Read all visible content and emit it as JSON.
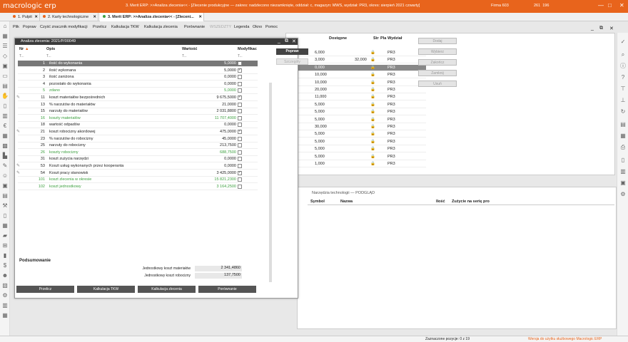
{
  "app": {
    "logo": "macrologic erp",
    "title": "3. Merit ERP: >>Analiza zlecenia<< - [Zlecenie produkcyjne — zakres: nadzlecono niezamknięte, oddział: c, magazyn: MWS, wydział: PR3, okres: sierpień 2021 czwarty]",
    "firma": "Firma 603",
    "num1": "261",
    "num2": "196"
  },
  "tabs": [
    {
      "label": "1. Pulpit",
      "color": "#e8641c"
    },
    {
      "label": "2. Karty technologiczne",
      "color": "#e8641c"
    },
    {
      "label": "3. Merit ERP: >>Analiza zlecenia<< - [Zleceni...",
      "color": "#3ea040"
    }
  ],
  "menu": [
    "Plik",
    "Popraw",
    "Czyść znacznik modyfikacji",
    "Przelicz",
    "Kalkulacja TKW",
    "Kalkulacja zlecenia",
    "Porównanie",
    "WSZEDZTY",
    "Legenda",
    "Okno",
    "Pomoc"
  ],
  "bg": {
    "headers": {
      "dostepne": "Dostępne",
      "str": "Str",
      "pla": "Pla",
      "wydzial": "Wydział"
    },
    "rows": [
      {
        "a": "6,000",
        "b": "",
        "w": "PR3"
      },
      {
        "a": "3,000",
        "b": "32,000",
        "w": "PR3"
      },
      {
        "a": "0,000",
        "b": "",
        "w": "PR3"
      },
      {
        "a": "10,000",
        "b": "",
        "w": "PR3"
      },
      {
        "a": "10,000",
        "b": "",
        "w": "PR3"
      },
      {
        "a": "20,000",
        "b": "",
        "w": "PR3"
      },
      {
        "a": "11,000",
        "b": "",
        "w": "PR3"
      },
      {
        "a": "5,000",
        "b": "",
        "w": "PR3"
      },
      {
        "a": "5,000",
        "b": "",
        "w": "PR3"
      },
      {
        "a": "5,000",
        "b": "",
        "w": "PR3"
      },
      {
        "a": "30,000",
        "b": "",
        "w": "PR3"
      },
      {
        "a": "5,000",
        "b": "",
        "w": "PR3"
      },
      {
        "a": "5,000",
        "b": "",
        "w": "PR3"
      },
      {
        "a": "5,000",
        "b": "",
        "w": "PR3"
      },
      {
        "a": "5,000",
        "b": "",
        "w": "PR3"
      },
      {
        "a": "1,000",
        "b": "",
        "w": "PR3"
      }
    ],
    "buttons": [
      "Dodaj",
      "Wybierz",
      "Zakończ",
      "Zamknij",
      "Usuń"
    ]
  },
  "lower": {
    "tab": "Narzędzia technologii — PODGLĄD",
    "symbol": "Symbol",
    "nazwa": "Nazwa",
    "ilosc": "Ilość",
    "zuzycie": "Zużycie na serię pro"
  },
  "dialog": {
    "title": "Analiza zlecenia: 2021/P/00049",
    "h_nr": "Nr",
    "h_opis": "Opis",
    "h_wartosc": "Wartość",
    "h_modyf": "Modyfikac",
    "filter": "T...",
    "btn_popraw": "Popraw",
    "btn_szczegoly": "Szczegóły",
    "rows": [
      {
        "nr": "1",
        "opis": "ilość do wykonania",
        "val": "5,0000",
        "chk": false,
        "sel": true,
        "green": false,
        "pen": false
      },
      {
        "nr": "2",
        "opis": "ilość wykonana",
        "val": "5,0000",
        "chk": true,
        "sel": false,
        "green": false,
        "pen": false
      },
      {
        "nr": "3",
        "opis": "ilość zaniżona",
        "val": "0,0000",
        "chk": false,
        "sel": false,
        "green": false,
        "pen": false
      },
      {
        "nr": "4",
        "opis": "pozostało do wykonania",
        "val": "0,0000",
        "chk": false,
        "sel": false,
        "green": false,
        "pen": false
      },
      {
        "nr": "5",
        "opis": "zdano",
        "val": "5,0000",
        "chk": false,
        "sel": false,
        "green": true,
        "pen": false
      },
      {
        "nr": "11",
        "opis": "koszt materiałów bezpośrednich",
        "val": "9 675,5000",
        "chk": true,
        "sel": false,
        "green": false,
        "pen": true
      },
      {
        "nr": "13",
        "opis": "% narzutów do materiałów",
        "val": "21,0000",
        "chk": false,
        "sel": false,
        "green": false,
        "pen": false
      },
      {
        "nr": "15",
        "opis": "narzuty do materiałów",
        "val": "2 031,8800",
        "chk": false,
        "sel": false,
        "green": false,
        "pen": false
      },
      {
        "nr": "16",
        "opis": "koszty materiałów",
        "val": "11 707,4000",
        "chk": false,
        "sel": false,
        "green": true,
        "pen": false
      },
      {
        "nr": "18",
        "opis": "wartość odpadów",
        "val": "0,0000",
        "chk": false,
        "sel": false,
        "green": false,
        "pen": false
      },
      {
        "nr": "21",
        "opis": "koszt robocizny akordowej",
        "val": "475,0000",
        "chk": true,
        "sel": false,
        "green": false,
        "pen": true
      },
      {
        "nr": "23",
        "opis": "% narzutów do robocizny",
        "val": "45,0000",
        "chk": false,
        "sel": false,
        "green": false,
        "pen": false
      },
      {
        "nr": "25",
        "opis": "narzuty do robocizny",
        "val": "213,7500",
        "chk": false,
        "sel": false,
        "green": false,
        "pen": false
      },
      {
        "nr": "26",
        "opis": "koszty robocizny",
        "val": "688,7500",
        "chk": false,
        "sel": false,
        "green": true,
        "pen": false
      },
      {
        "nr": "31",
        "opis": "koszt zużycia narzędzi",
        "val": "0,0000",
        "chk": false,
        "sel": false,
        "green": false,
        "pen": false
      },
      {
        "nr": "53",
        "opis": "Koszt usług wykonanych przez kooperanta",
        "val": "0,0000",
        "chk": false,
        "sel": false,
        "green": false,
        "pen": true
      },
      {
        "nr": "54",
        "opis": "Koszt pracy stanowisk",
        "val": "3 425,0000",
        "chk": true,
        "sel": false,
        "green": false,
        "pen": true
      },
      {
        "nr": "101",
        "opis": "koszt zlecenia w okresie",
        "val": "15 821,2300",
        "chk": false,
        "sel": false,
        "green": true,
        "pen": false
      },
      {
        "nr": "102",
        "opis": "koszt jednostkowy",
        "val": "3 164,2500",
        "chk": false,
        "sel": false,
        "green": true,
        "pen": false
      }
    ],
    "summary": {
      "title": "Podsumowanie",
      "l1": "Jednostkowy koszt materiałów",
      "v1": "2 341,4860",
      "l2": "Jednostkowy koszt robocizny",
      "v2": "137,7500"
    },
    "bottom": [
      "Przelicz",
      "Kalkulacja TKW",
      "Kalkulacja zlecenia",
      "Porównanie"
    ]
  },
  "status": {
    "sel": "Zaznaczone pozycje: 0 z 19",
    "version": "Wersja do użytku służbowego Macrologic ERP"
  }
}
